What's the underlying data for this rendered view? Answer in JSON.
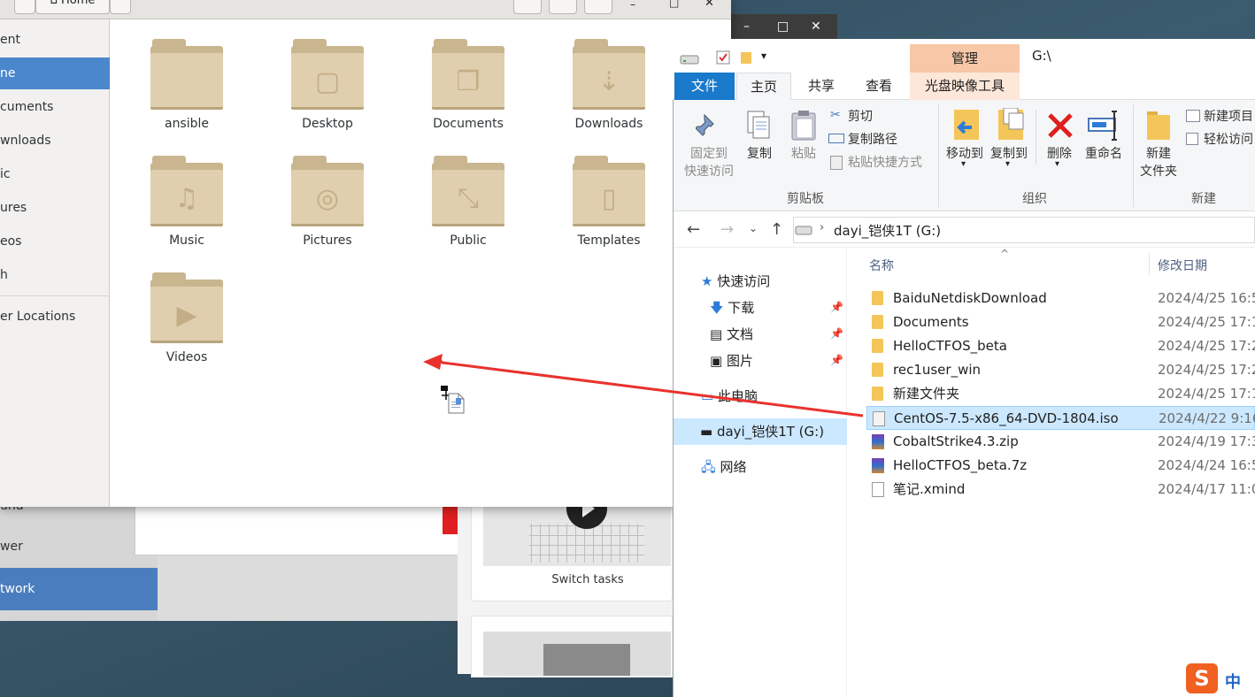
{
  "background_settings": {
    "sidebar_items": [
      "und",
      "wer",
      "twork"
    ],
    "help_caption": "Switch tasks"
  },
  "dark_window": {
    "controls": [
      "–",
      "□",
      "✕"
    ]
  },
  "files": {
    "location": "Home",
    "sidebar": [
      "ent",
      "ne",
      "cuments",
      "wnloads",
      "ic",
      "ures",
      "eos",
      "h",
      "er Locations"
    ],
    "selected_index": 1,
    "folders": [
      {
        "name": "ansible",
        "icon": "folder-icon",
        "glyph": ""
      },
      {
        "name": "Desktop",
        "icon": "folder-desktop-icon",
        "glyph": "▢"
      },
      {
        "name": "Documents",
        "icon": "folder-documents-icon",
        "glyph": "❐"
      },
      {
        "name": "Downloads",
        "icon": "folder-download-icon",
        "glyph": "⇣"
      },
      {
        "name": "Music",
        "icon": "folder-music-icon",
        "glyph": "♫"
      },
      {
        "name": "Pictures",
        "icon": "folder-pictures-icon",
        "glyph": "◎"
      },
      {
        "name": "Public",
        "icon": "folder-public-icon",
        "glyph": "⤡"
      },
      {
        "name": "Templates",
        "icon": "folder-templates-icon",
        "glyph": "▯"
      },
      {
        "name": "Videos",
        "icon": "folder-videos-icon",
        "glyph": "▶"
      }
    ]
  },
  "explorer": {
    "title": "G:\\",
    "manage_tab": "管理",
    "tabs": {
      "file": "文件",
      "home": "主页",
      "share": "共享",
      "view": "查看",
      "disc_tools": "光盘映像工具"
    },
    "ribbon": {
      "pin_label": "固定到\n快速访问",
      "copy_label": "复制",
      "paste_label": "粘贴",
      "cut_label": "剪切",
      "copy_path_label": "复制路径",
      "paste_shortcut_label": "粘贴快捷方式",
      "clipboard_group": "剪贴板",
      "move_to_label": "移动到",
      "copy_to_label": "复制到",
      "delete_label": "删除",
      "rename_label": "重命名",
      "organize_group": "组织",
      "new_folder_label": "新建\n文件夹",
      "new_item_label": "新建项目",
      "easy_access_label": "轻松访问",
      "new_group": "新建"
    },
    "address": {
      "crumb": "dayi_铠侠1T (G:)"
    },
    "nav": {
      "quick_access": "快速访问",
      "downloads": "下载",
      "documents": "文档",
      "pictures": "图片",
      "this_pc": "此电脑",
      "drive": "dayi_铠侠1T (G:)",
      "network": "网络"
    },
    "columns": {
      "name": "名称",
      "date": "修改日期"
    },
    "files": [
      {
        "name": "BaiduNetdiskDownload",
        "date": "2024/4/25 16:5",
        "type": "folder"
      },
      {
        "name": "Documents",
        "date": "2024/4/25 17:1",
        "type": "folder"
      },
      {
        "name": "HelloCTFOS_beta",
        "date": "2024/4/25 17:2",
        "type": "folder"
      },
      {
        "name": "rec1user_win",
        "date": "2024/4/25 17:2",
        "type": "folder"
      },
      {
        "name": "新建文件夹",
        "date": "2024/4/25 17:1",
        "type": "folder"
      },
      {
        "name": "CentOS-7.5-x86_64-DVD-1804.iso",
        "date": "2024/4/22 9:16",
        "type": "iso"
      },
      {
        "name": "CobaltStrike4.3.zip",
        "date": "2024/4/19 17:3",
        "type": "archive"
      },
      {
        "name": "HelloCTFOS_beta.7z",
        "date": "2024/4/24 16:5",
        "type": "archive"
      },
      {
        "name": "笔记.xmind",
        "date": "2024/4/17 11:0",
        "type": "file"
      }
    ],
    "selected_file_index": 5
  },
  "ime": {
    "label": "中"
  },
  "accent_colors": {
    "arrow": "#e8322e",
    "nautilus_select": "#4a87cc",
    "explorer_file_tab": "#1979ca",
    "selection": "#cce8ff"
  }
}
